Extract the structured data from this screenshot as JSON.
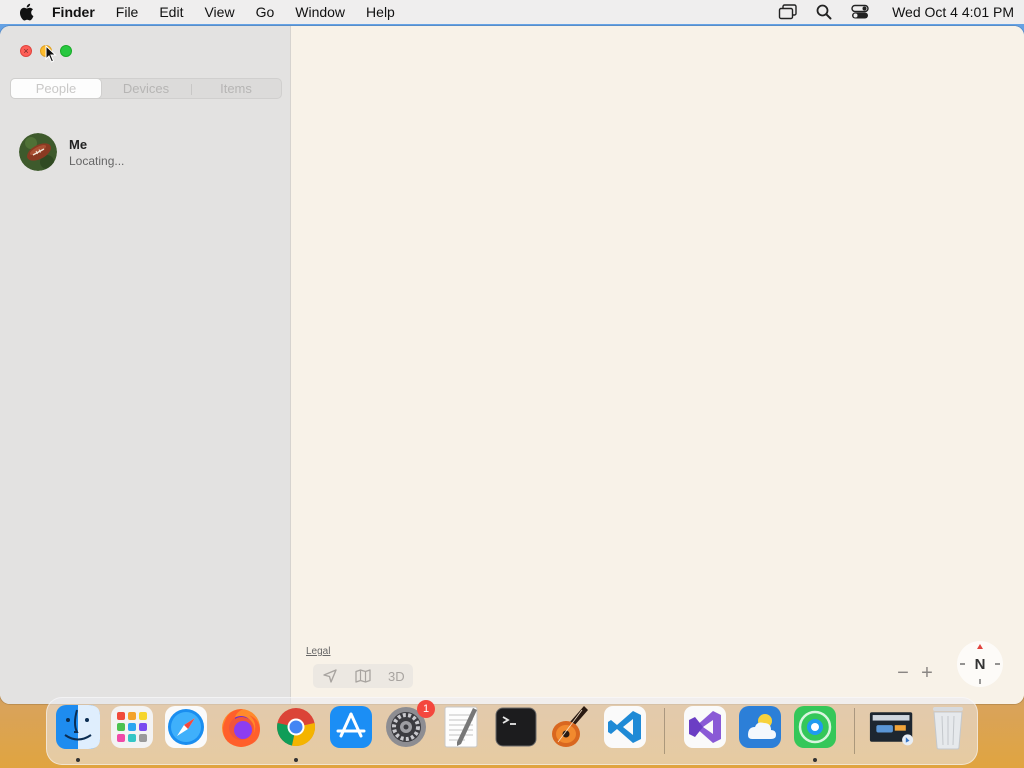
{
  "menubar": {
    "app_name": "Finder",
    "items": [
      "File",
      "Edit",
      "View",
      "Go",
      "Window",
      "Help"
    ],
    "clock": "Wed Oct 4  4:01 PM"
  },
  "sidebar": {
    "tabs": [
      {
        "label": "People",
        "active": true
      },
      {
        "label": "Devices",
        "active": false
      },
      {
        "label": "Items",
        "active": false
      }
    ],
    "people": [
      {
        "name": "Me",
        "status": "Locating..."
      }
    ]
  },
  "map": {
    "legal": "Legal",
    "view_3d": "3D",
    "zoom_out": "−",
    "zoom_in": "+",
    "compass": "N"
  },
  "dock": {
    "apps": [
      {
        "name": "Finder",
        "icon": "finder-icon",
        "running": true
      },
      {
        "name": "Launchpad",
        "icon": "launchpad-icon",
        "running": false
      },
      {
        "name": "Safari",
        "icon": "safari-icon",
        "running": false
      },
      {
        "name": "Firefox",
        "icon": "firefox-icon",
        "running": false
      },
      {
        "name": "Chrome",
        "icon": "chrome-icon",
        "running": true
      },
      {
        "name": "App Store",
        "icon": "app-store-icon",
        "running": false
      },
      {
        "name": "System Settings",
        "icon": "settings-icon",
        "running": false,
        "badge": "1"
      },
      {
        "name": "TextEdit",
        "icon": "textedit-icon",
        "running": false
      },
      {
        "name": "Terminal",
        "icon": "terminal-icon",
        "running": false
      },
      {
        "name": "GarageBand",
        "icon": "garageband-icon",
        "running": false
      },
      {
        "name": "VS Code",
        "icon": "vscode-icon",
        "running": false
      },
      {
        "name": "Visual Studio",
        "icon": "visual-studio-icon",
        "running": false
      },
      {
        "name": "Weather",
        "icon": "weather-icon",
        "running": false
      },
      {
        "name": "Find My",
        "icon": "findmy-icon",
        "running": true
      },
      {
        "name": "Downloads",
        "icon": "downloads-stack-icon",
        "running": false
      },
      {
        "name": "Trash",
        "icon": "trash-icon",
        "running": false
      }
    ]
  },
  "colors": {
    "close": "#fe5f57",
    "minimize": "#febc2e",
    "maximize": "#28c840",
    "map_bg": "#f8f2e8",
    "sidebar_bg": "#e3e2e1"
  }
}
